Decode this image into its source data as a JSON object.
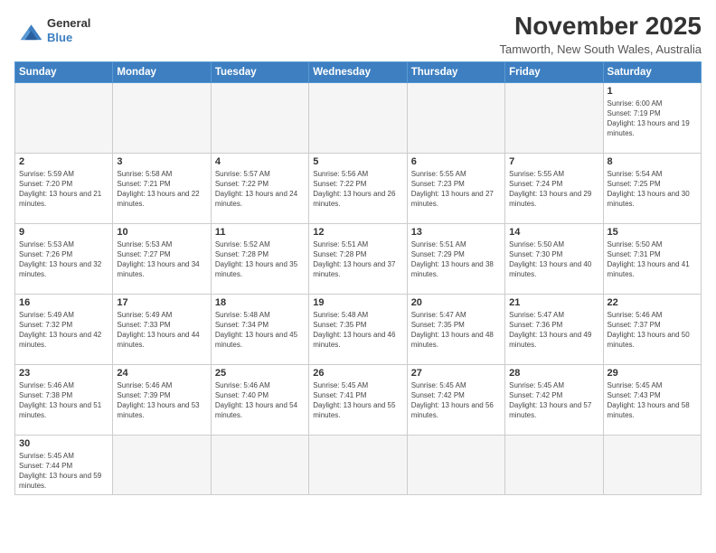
{
  "header": {
    "logo_line1": "General",
    "logo_line2": "Blue",
    "month_title": "November 2025",
    "location": "Tamworth, New South Wales, Australia"
  },
  "weekdays": [
    "Sunday",
    "Monday",
    "Tuesday",
    "Wednesday",
    "Thursday",
    "Friday",
    "Saturday"
  ],
  "weeks": [
    [
      {
        "day": "",
        "info": ""
      },
      {
        "day": "",
        "info": ""
      },
      {
        "day": "",
        "info": ""
      },
      {
        "day": "",
        "info": ""
      },
      {
        "day": "",
        "info": ""
      },
      {
        "day": "",
        "info": ""
      },
      {
        "day": "1",
        "info": "Sunrise: 6:00 AM\nSunset: 7:19 PM\nDaylight: 13 hours and 19 minutes."
      }
    ],
    [
      {
        "day": "2",
        "info": "Sunrise: 5:59 AM\nSunset: 7:20 PM\nDaylight: 13 hours and 21 minutes."
      },
      {
        "day": "3",
        "info": "Sunrise: 5:58 AM\nSunset: 7:21 PM\nDaylight: 13 hours and 22 minutes."
      },
      {
        "day": "4",
        "info": "Sunrise: 5:57 AM\nSunset: 7:22 PM\nDaylight: 13 hours and 24 minutes."
      },
      {
        "day": "5",
        "info": "Sunrise: 5:56 AM\nSunset: 7:22 PM\nDaylight: 13 hours and 26 minutes."
      },
      {
        "day": "6",
        "info": "Sunrise: 5:55 AM\nSunset: 7:23 PM\nDaylight: 13 hours and 27 minutes."
      },
      {
        "day": "7",
        "info": "Sunrise: 5:55 AM\nSunset: 7:24 PM\nDaylight: 13 hours and 29 minutes."
      },
      {
        "day": "8",
        "info": "Sunrise: 5:54 AM\nSunset: 7:25 PM\nDaylight: 13 hours and 30 minutes."
      }
    ],
    [
      {
        "day": "9",
        "info": "Sunrise: 5:53 AM\nSunset: 7:26 PM\nDaylight: 13 hours and 32 minutes."
      },
      {
        "day": "10",
        "info": "Sunrise: 5:53 AM\nSunset: 7:27 PM\nDaylight: 13 hours and 34 minutes."
      },
      {
        "day": "11",
        "info": "Sunrise: 5:52 AM\nSunset: 7:28 PM\nDaylight: 13 hours and 35 minutes."
      },
      {
        "day": "12",
        "info": "Sunrise: 5:51 AM\nSunset: 7:28 PM\nDaylight: 13 hours and 37 minutes."
      },
      {
        "day": "13",
        "info": "Sunrise: 5:51 AM\nSunset: 7:29 PM\nDaylight: 13 hours and 38 minutes."
      },
      {
        "day": "14",
        "info": "Sunrise: 5:50 AM\nSunset: 7:30 PM\nDaylight: 13 hours and 40 minutes."
      },
      {
        "day": "15",
        "info": "Sunrise: 5:50 AM\nSunset: 7:31 PM\nDaylight: 13 hours and 41 minutes."
      }
    ],
    [
      {
        "day": "16",
        "info": "Sunrise: 5:49 AM\nSunset: 7:32 PM\nDaylight: 13 hours and 42 minutes."
      },
      {
        "day": "17",
        "info": "Sunrise: 5:49 AM\nSunset: 7:33 PM\nDaylight: 13 hours and 44 minutes."
      },
      {
        "day": "18",
        "info": "Sunrise: 5:48 AM\nSunset: 7:34 PM\nDaylight: 13 hours and 45 minutes."
      },
      {
        "day": "19",
        "info": "Sunrise: 5:48 AM\nSunset: 7:35 PM\nDaylight: 13 hours and 46 minutes."
      },
      {
        "day": "20",
        "info": "Sunrise: 5:47 AM\nSunset: 7:35 PM\nDaylight: 13 hours and 48 minutes."
      },
      {
        "day": "21",
        "info": "Sunrise: 5:47 AM\nSunset: 7:36 PM\nDaylight: 13 hours and 49 minutes."
      },
      {
        "day": "22",
        "info": "Sunrise: 5:46 AM\nSunset: 7:37 PM\nDaylight: 13 hours and 50 minutes."
      }
    ],
    [
      {
        "day": "23",
        "info": "Sunrise: 5:46 AM\nSunset: 7:38 PM\nDaylight: 13 hours and 51 minutes."
      },
      {
        "day": "24",
        "info": "Sunrise: 5:46 AM\nSunset: 7:39 PM\nDaylight: 13 hours and 53 minutes."
      },
      {
        "day": "25",
        "info": "Sunrise: 5:46 AM\nSunset: 7:40 PM\nDaylight: 13 hours and 54 minutes."
      },
      {
        "day": "26",
        "info": "Sunrise: 5:45 AM\nSunset: 7:41 PM\nDaylight: 13 hours and 55 minutes."
      },
      {
        "day": "27",
        "info": "Sunrise: 5:45 AM\nSunset: 7:42 PM\nDaylight: 13 hours and 56 minutes."
      },
      {
        "day": "28",
        "info": "Sunrise: 5:45 AM\nSunset: 7:42 PM\nDaylight: 13 hours and 57 minutes."
      },
      {
        "day": "29",
        "info": "Sunrise: 5:45 AM\nSunset: 7:43 PM\nDaylight: 13 hours and 58 minutes."
      }
    ],
    [
      {
        "day": "30",
        "info": "Sunrise: 5:45 AM\nSunset: 7:44 PM\nDaylight: 13 hours and 59 minutes."
      },
      {
        "day": "",
        "info": ""
      },
      {
        "day": "",
        "info": ""
      },
      {
        "day": "",
        "info": ""
      },
      {
        "day": "",
        "info": ""
      },
      {
        "day": "",
        "info": ""
      },
      {
        "day": "",
        "info": ""
      }
    ]
  ]
}
